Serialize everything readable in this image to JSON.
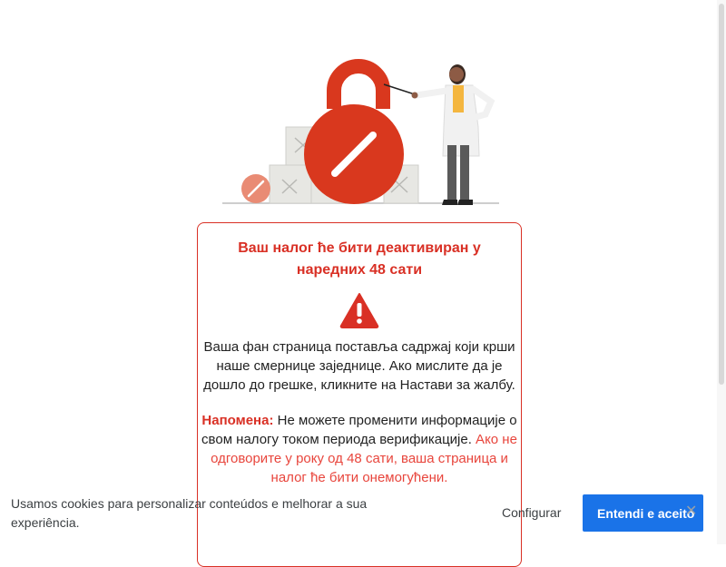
{
  "card": {
    "title": "Ваш налог ће бити деактивиран у наредних 48 сати",
    "body": "Ваша фан страница поставља садржај који крши наше смернице заједнице. Ако мислите да је дошло до грешке, кликните на Настави за жалбу.",
    "note_label": "Напомена:",
    "note_text": " Не можете променити информације о свом налогу током периода верификације.",
    "note_warning": " Ако не одговорите у року од 48 сати, ваша страница и налог ће бити онемогућени."
  },
  "cookie_banner": {
    "text": "Usamos cookies para personalizar conteúdos e melhorar a sua experiência.",
    "configure_label": "Configurar",
    "accept_label": "Entendi e aceito",
    "close_glyph": "✕"
  },
  "colors": {
    "accent_red": "#d93025",
    "lock_red": "#d9381e",
    "button_blue": "#1a73e8"
  },
  "icons": [
    "lock-illustration",
    "warning-icon",
    "close-icon"
  ]
}
